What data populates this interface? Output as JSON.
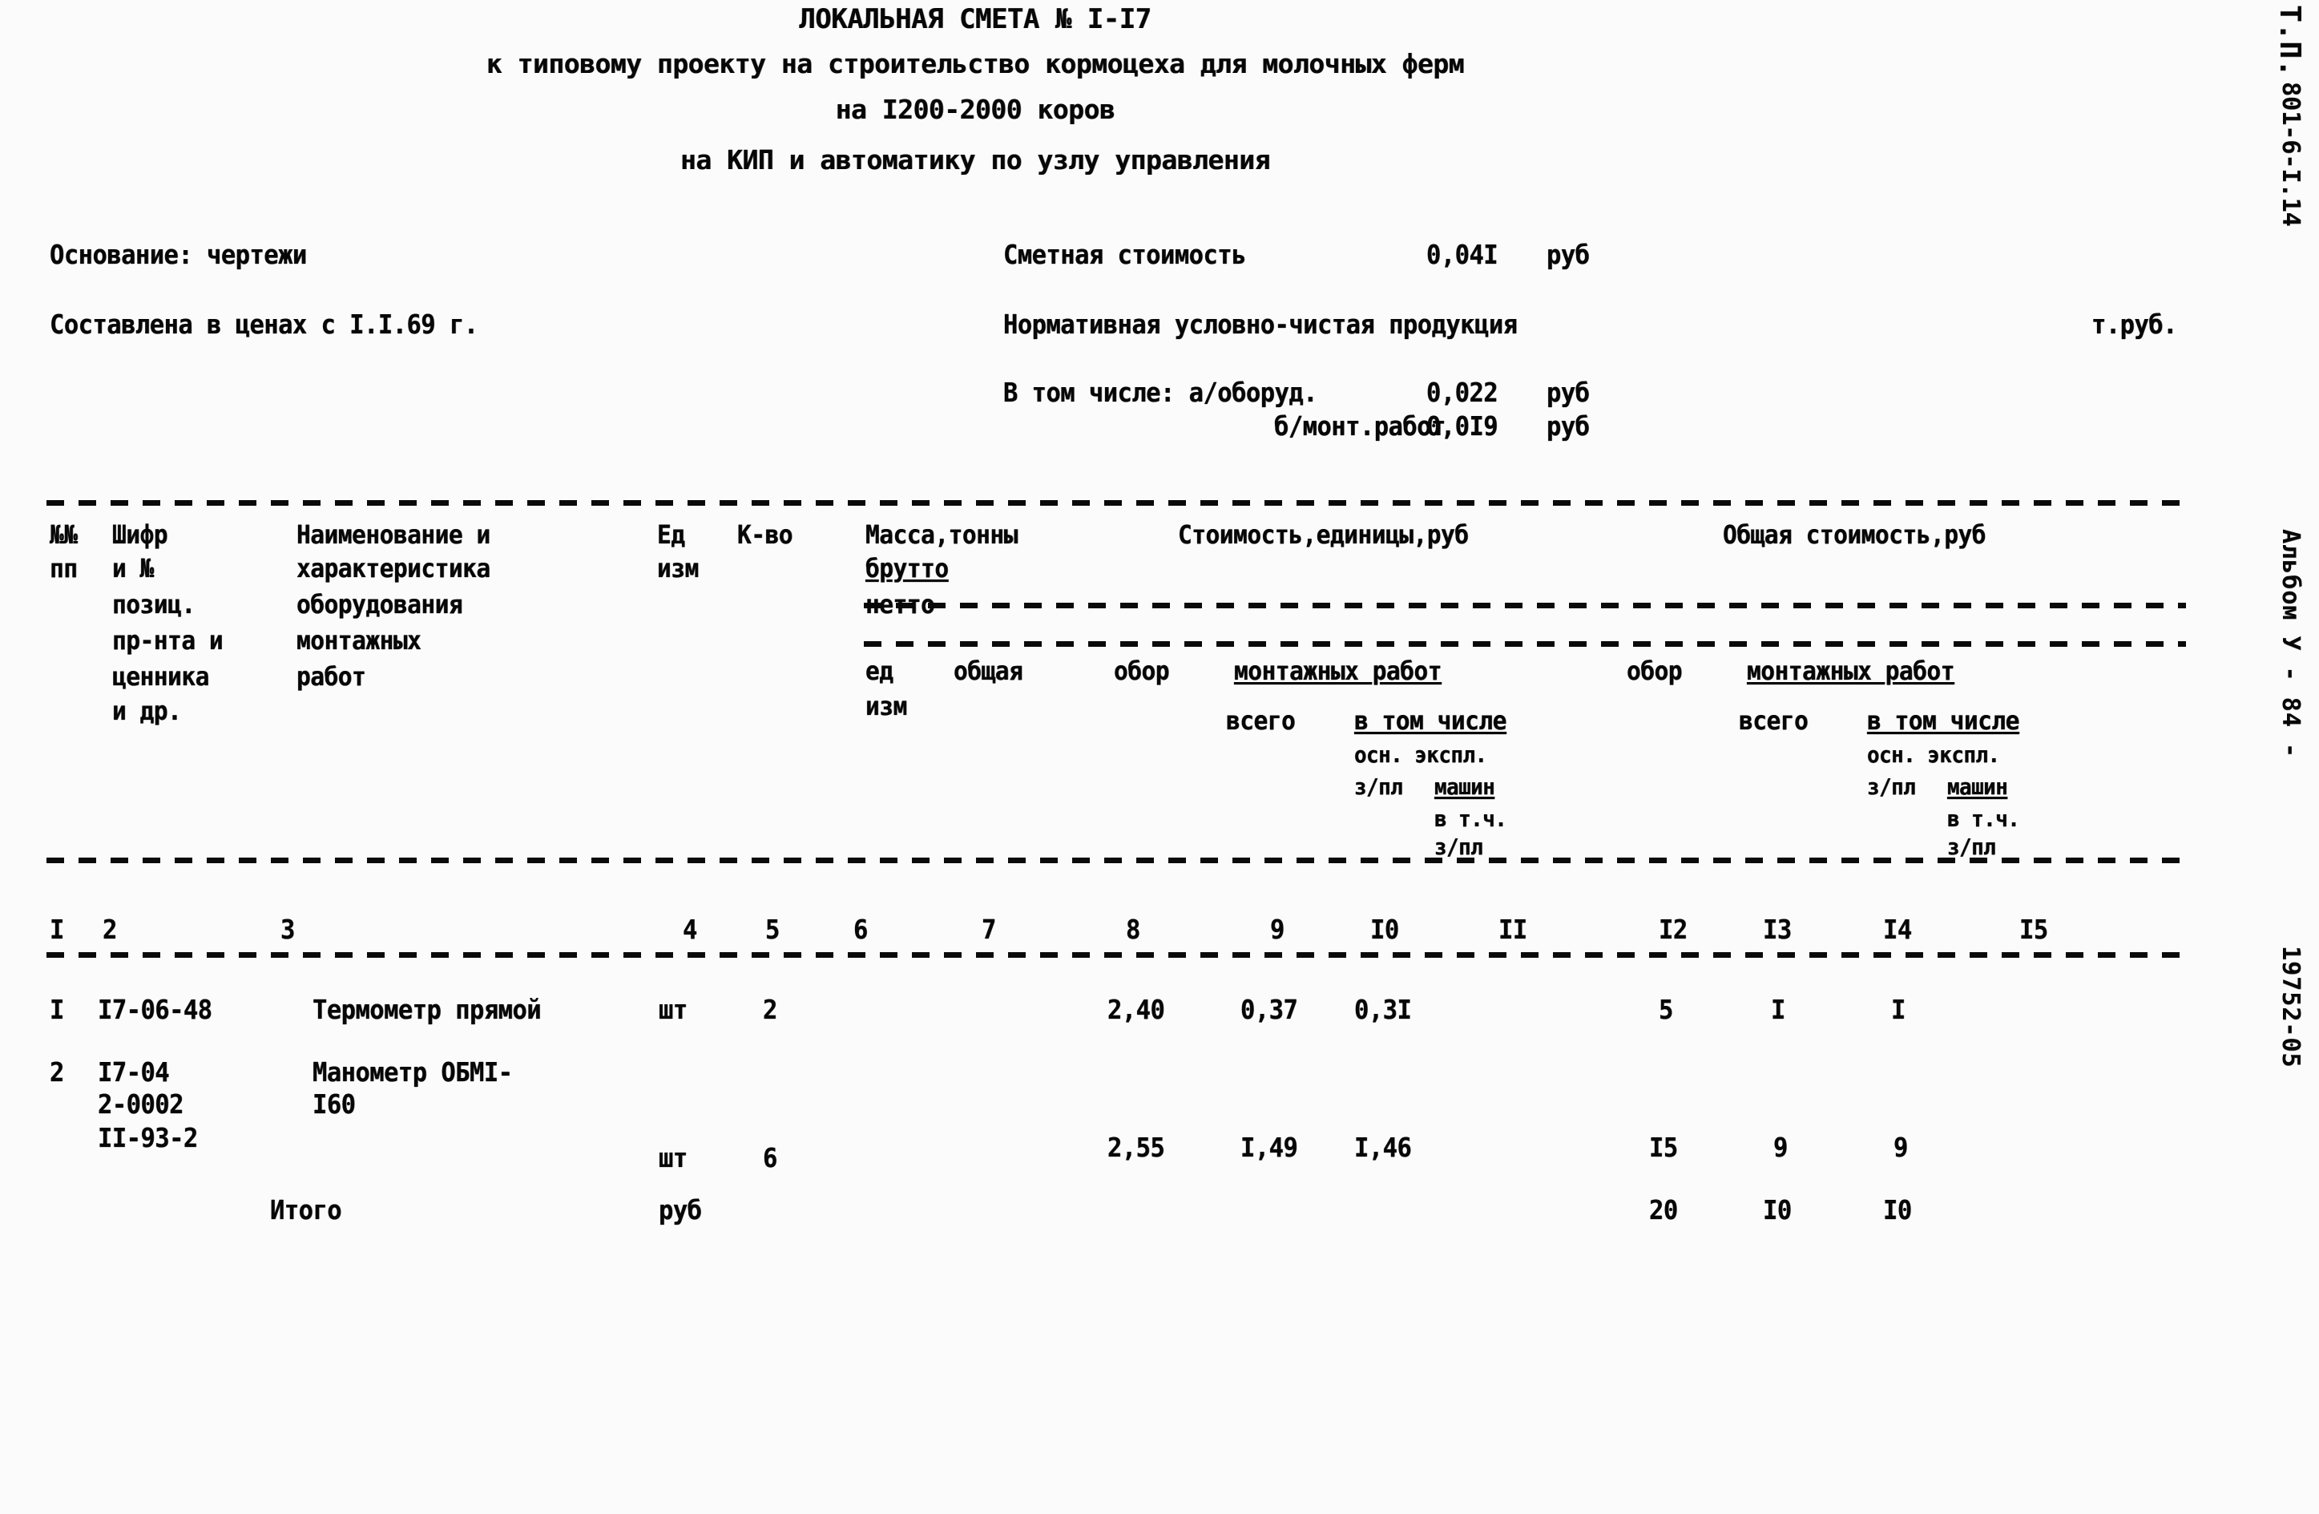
{
  "document": {
    "title_line_1": "ЛОКАЛЬНАЯ СМЕТА № I-I7",
    "title_line_2": "к типовому проекту на строительство кормоцеха для молочных ферм",
    "title_line_3": "на I200-2000 коров",
    "title_line_4": "на КИП и автоматику по узлу управления"
  },
  "meta": {
    "basis_label": "Основание: чертежи",
    "prices_label": "Составлена в ценах с I.I.69 г.",
    "estimate_cost_label": "Сметная стоимость",
    "estimate_cost_value": "0,04I",
    "estimate_cost_unit": "руб",
    "net_product_label": "Нормативная условно-чистая продукция",
    "net_product_unit": "т.руб.",
    "including_label": "В том числе: а/оборуд.",
    "including_equipment_value": "0,022",
    "including_equipment_unit": "руб",
    "including_works_label": "б/монт.работ",
    "including_works_value": "0,0I9",
    "including_works_unit": "руб"
  },
  "table_header": {
    "col1_line1": "№№",
    "col1_line2": "пп",
    "col2_line1": "Шифр",
    "col2_line2": "и №",
    "col2_line3": "позиц.",
    "col2_line4": "пр-нта и",
    "col2_line5": "ценника",
    "col3_line1": "Наименование и",
    "col3_line2": "характеристика",
    "col3_line3": "оборудования",
    "col3_line4": "монтажных",
    "col3_line5": "работ",
    "col3_line6": "и др.",
    "col4_line1": "Ед",
    "col4_line2": "изм",
    "col5": "К-во",
    "mass_group": "Масса,тонны",
    "mass_brutto": "брутто",
    "mass_netto": "нетто",
    "mass_unit_line1": "ед",
    "mass_unit_line2": "изм",
    "mass_total": "общая",
    "unit_cost_group": "Стоимость,единицы,руб",
    "total_cost_group": "Общая стоимость,руб",
    "equip_a": "обор",
    "mont_works_a": "монтажных работ",
    "equip_b": "обор",
    "mont_works_b": "монтажных работ",
    "vsego_a": "всего",
    "vtomchisle_a": "в том числе",
    "osn_exp_a": "осн. экспл.",
    "zpl_mashin_a_1": "з/пл",
    "zpl_mashin_a_2": "машин",
    "vtch_a": "в т.ч.",
    "zpl_a": "з/пл",
    "vsego_b": "всего",
    "vtomchisle_b": "в том числе",
    "osn_exp_b": "осн. экспл.",
    "zpl_mashin_b_1": "з/пл",
    "zpl_mashin_b_2": "машин",
    "vtch_b": "в т.ч.",
    "zpl_b": "з/пл"
  },
  "column_numbers": [
    "I",
    "2",
    "3",
    "4",
    "5",
    "6",
    "7",
    "8",
    "9",
    "I0",
    "II",
    "I2",
    "I3",
    "I4",
    "I5"
  ],
  "rows": [
    {
      "num": "I",
      "code_l1": "I7-06-48",
      "code_l2": "",
      "code_l3": "",
      "name_l1": "Термометр прямой",
      "name_l2": "",
      "unit": "шт",
      "qty": "2",
      "mass_unit": "",
      "mass_total": "",
      "equip_unit": "",
      "mont_vsego": "2,40",
      "mont_osn": "0,37",
      "mont_exp": "0,3I",
      "mont_zpl": "",
      "equip_total": "",
      "total_vsego": "5",
      "total_osn": "I",
      "total_exp": "I",
      "total_zpl": ""
    },
    {
      "num": "2",
      "code_l1": "I7-04",
      "code_l2": "2-0002",
      "code_l3": "II-93-2",
      "name_l1": "Манометр ОБМI-",
      "name_l2": "I60",
      "unit": "шт",
      "qty": "6",
      "mass_unit": "",
      "mass_total": "",
      "equip_unit": "",
      "mont_vsego": "2,55",
      "mont_osn": "I,49",
      "mont_exp": "I,46",
      "mont_zpl": "",
      "equip_total": "",
      "total_vsego": "I5",
      "total_osn": "9",
      "total_exp": "9",
      "total_zpl": ""
    }
  ],
  "total_row": {
    "label": "Итого",
    "unit": "руб",
    "total_vsego": "20",
    "total_osn": "I0",
    "total_exp": "I0"
  },
  "margin": {
    "top_code": "Т.П.",
    "top_code_2": "801-6-I.14",
    "album": "Альбом У - 84 -",
    "doc_number": "19752-05"
  }
}
